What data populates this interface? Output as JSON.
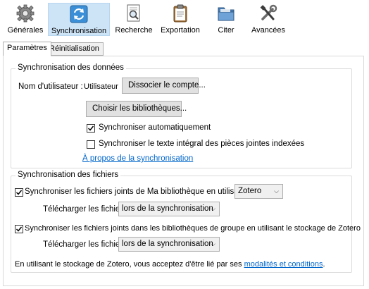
{
  "toolbar": {
    "items": [
      {
        "label": "Générales",
        "icon": "gear-icon"
      },
      {
        "label": "Synchronisation",
        "icon": "sync-icon",
        "selected": true
      },
      {
        "label": "Recherche",
        "icon": "search-document-icon"
      },
      {
        "label": "Exportation",
        "icon": "clipboard-icon"
      },
      {
        "label": "Citer",
        "icon": "folder-icon"
      },
      {
        "label": "Avancées",
        "icon": "tools-icon"
      }
    ]
  },
  "tabs": [
    {
      "label": "Paramètres",
      "active": true
    },
    {
      "label": "Réinitialisation",
      "active": false
    }
  ],
  "data_sync": {
    "title": "Synchronisation des données",
    "username_label": "Nom d'utilisateur :",
    "username_value": "Utilisateur",
    "unlink_button": "Dissocier le compte...",
    "choose_libraries_button": "Choisir les bibliothèques...",
    "auto_sync_label": "Synchroniser automatiquement",
    "auto_sync_checked": true,
    "fulltext_label": "Synchroniser le texte intégral des pièces jointes indexées",
    "fulltext_checked": false,
    "about_link": "À propos de la synchronisation"
  },
  "file_sync": {
    "title": "Synchronisation des fichiers",
    "my_library_label": "Synchroniser les fichiers joints de Ma bibliothèque en utilisant",
    "my_library_checked": true,
    "my_library_method": "Zotero",
    "download_label_1": "Télécharger les fichiers",
    "download_value_1": "lors de la synchronisation",
    "group_label": "Synchroniser les fichiers joints dans les bibliothèques de groupe en utilisant le stockage de Zotero",
    "group_checked": true,
    "download_label_2": "Télécharger les fichiers",
    "download_value_2": "lors de la synchronisation",
    "terms_prefix": "En utilisant le stockage de Zotero, vous acceptez d'être lié par ses",
    "terms_link": "modalités et conditions",
    "terms_suffix": "."
  },
  "colors": {
    "selected_bg": "#cde4f7",
    "link": "#0066cc",
    "button_bg": "#e1e1e1"
  }
}
